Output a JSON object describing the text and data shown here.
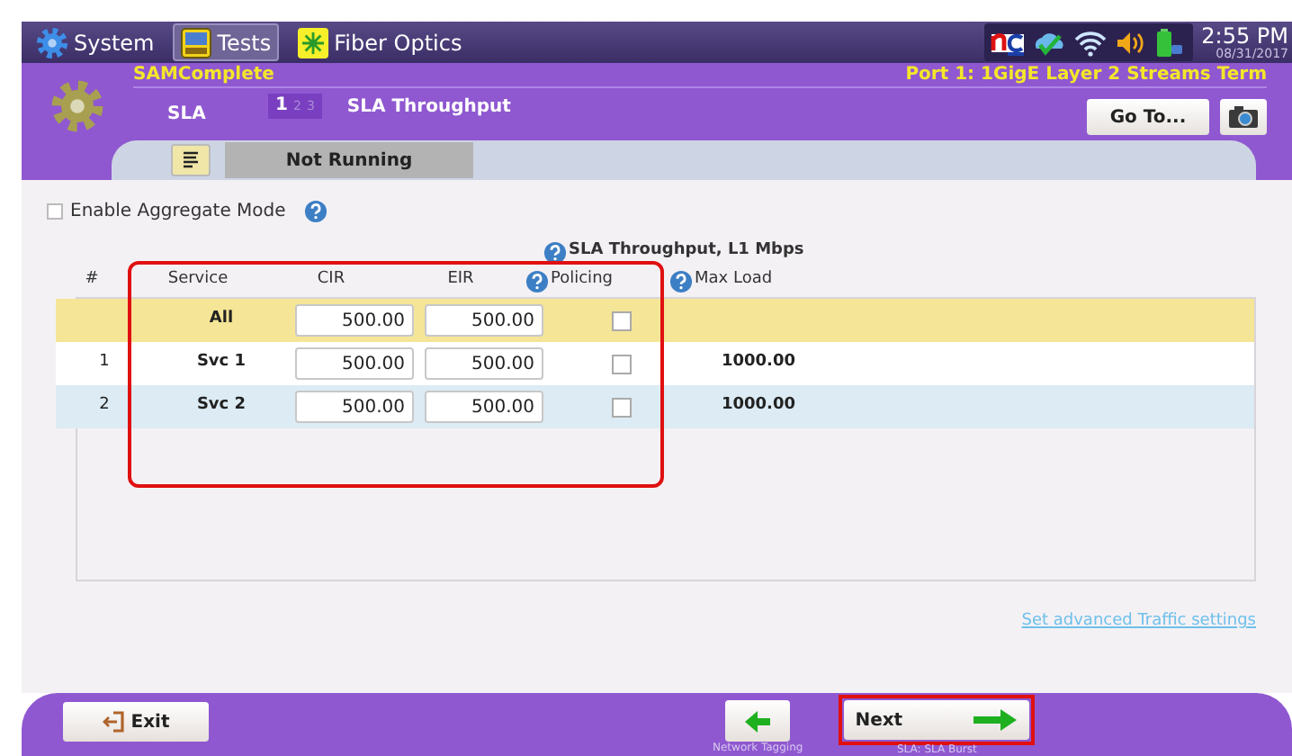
{
  "top_bar": {
    "tabs": [
      {
        "label": "System",
        "kind": "system",
        "selected": false
      },
      {
        "label": "Tests",
        "kind": "tests",
        "selected": true
      },
      {
        "label": "Fiber Optics",
        "kind": "fiber",
        "selected": false
      }
    ],
    "time": "2:55 PM",
    "date": "08/31/2017"
  },
  "header": {
    "test_name": "SAMComplete",
    "port": "Port 1: 1GigE Layer 2 Streams Term",
    "section": "SLA",
    "steps": [
      {
        "label": "1",
        "selected": true
      },
      {
        "label": "2",
        "selected": false
      },
      {
        "label": "3",
        "selected": false
      }
    ],
    "page": "SLA Throughput",
    "goto_button": "Go To..."
  },
  "status_strip": {
    "state": "Not Running"
  },
  "aggregate": {
    "label": "Enable Aggregate Mode",
    "checked": false
  },
  "table": {
    "group_header": "SLA Throughput, L1 Mbps",
    "highlighted": true,
    "columns": [
      "#",
      "Service",
      "CIR",
      "EIR",
      "Policing",
      "Max Load"
    ],
    "rows": [
      {
        "kind": "all",
        "service": "All",
        "cir": "500.00",
        "eir": "500.00",
        "policing": false
      },
      {
        "kind": "service",
        "number": "1",
        "service": "Svc 1",
        "cir": "500.00",
        "eir": "500.00",
        "policing": false,
        "max_load": "1000.00"
      },
      {
        "kind": "service",
        "number": "2",
        "service": "Svc 2",
        "cir": "500.00",
        "eir": "500.00",
        "policing": false,
        "max_load": "1000.00"
      }
    ]
  },
  "link": "Set advanced Traffic settings",
  "footer": {
    "exit": "Exit",
    "back_caption": "Network Tagging",
    "next": "Next",
    "next_caption": "SLA: SLA Burst",
    "next_highlighted": true
  }
}
